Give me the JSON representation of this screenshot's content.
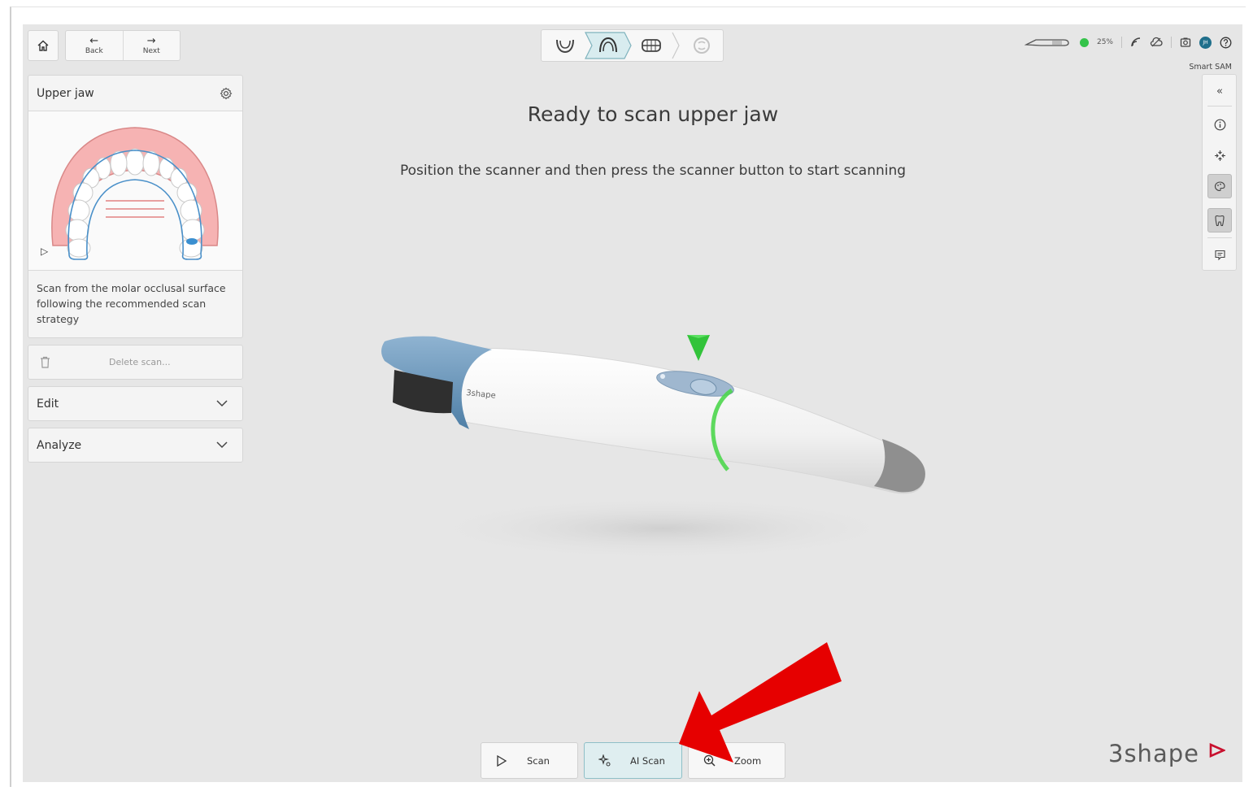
{
  "nav": {
    "back_label": "Back",
    "next_label": "Next"
  },
  "status": {
    "battery_pct": "25%",
    "avatar_initials": "JH",
    "smart_label": "Smart SAM"
  },
  "left_panel": {
    "card_title": "Upper jaw",
    "instruction": "Scan from the molar occlusal surface following the recommended scan strategy",
    "delete_label": "Delete scan...",
    "edit_label": "Edit",
    "analyze_label": "Analyze"
  },
  "main": {
    "title": "Ready to scan upper jaw",
    "subtitle": "Position the scanner and then press the scanner button to start scanning"
  },
  "scanner": {
    "brand_text": "3shape"
  },
  "bottom_toolbar": {
    "scan_label": "Scan",
    "ai_scan_label": "AI Scan",
    "zoom_label": "Zoom"
  },
  "brand": {
    "logo_text": "3shape"
  },
  "colors": {
    "accent": "#8fbfc7",
    "arrow": "#e60000",
    "status_green": "#34c34a",
    "scanner_blue": "#6b9bc1"
  }
}
